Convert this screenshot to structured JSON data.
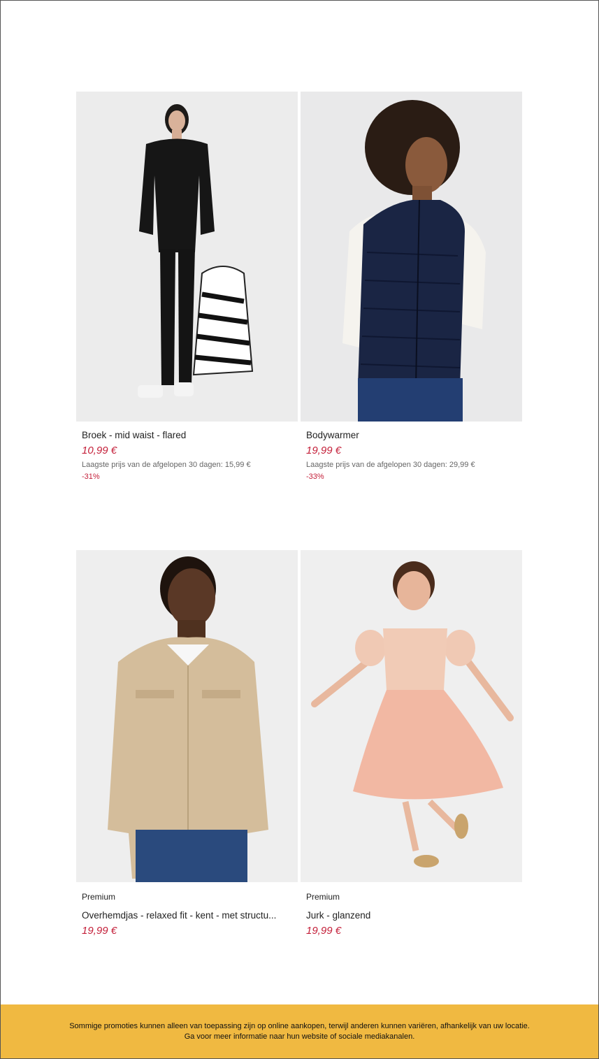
{
  "products": [
    {
      "name": "Broek - mid waist - flared",
      "price": "10,99 €",
      "lowest_price": "Laagste prijs van de afgelopen 30 dagen: 15,99 €",
      "discount": "-31%",
      "image_icon": "woman-black-outfit-photo"
    },
    {
      "name": "Bodywarmer",
      "price": "19,99 €",
      "lowest_price": "Laagste prijs van de afgelopen 30 dagen: 29,99 €",
      "discount": "-33%",
      "image_icon": "woman-navy-vest-photo"
    },
    {
      "brand": "Premium",
      "name": "Overhemdjas - relaxed fit - kent - met structu...",
      "price": "19,99 €",
      "image_icon": "man-beige-jacket-photo"
    },
    {
      "brand": "Premium",
      "name": "Jurk - glanzend",
      "price": "19,99 €",
      "image_icon": "girl-pink-dress-photo"
    }
  ],
  "disclaimer": "Sommige promoties kunnen alleen van toepassing zijn op online aankopen, terwijl anderen kunnen variëren, afhankelijk van uw locatie. Ga voor meer informatie naar hun website of sociale mediakanalen.",
  "colors": {
    "price": "#c4203a",
    "banner": "#f0b941"
  }
}
